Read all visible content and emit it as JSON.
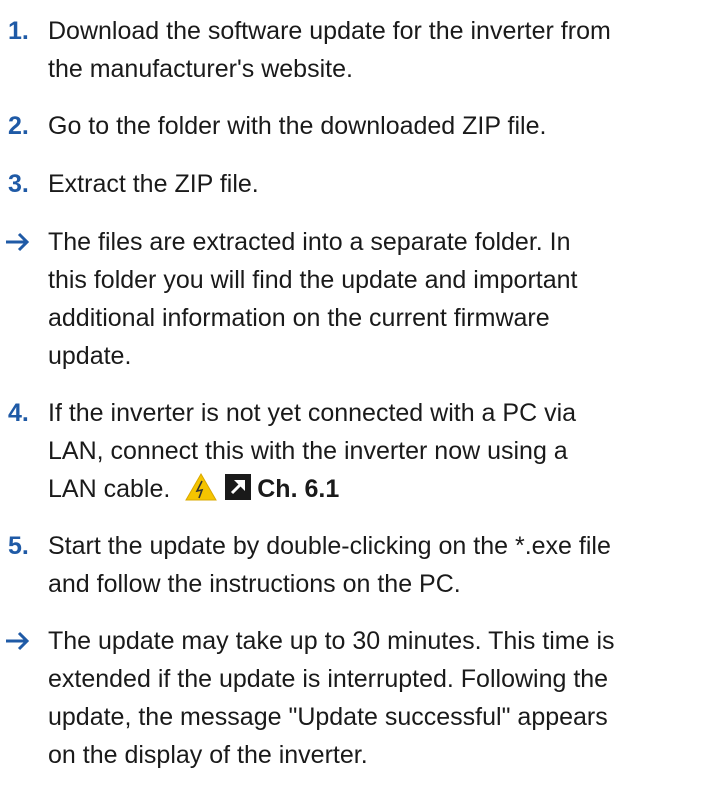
{
  "steps": [
    {
      "marker": "1.",
      "lines": [
        "Download the software update for the inverter from",
        "the manufacturer's website."
      ]
    },
    {
      "marker": "2.",
      "lines": [
        "Go to the folder with the downloaded ZIP file."
      ]
    },
    {
      "marker": "3.",
      "lines": [
        "Extract the ZIP file."
      ]
    },
    {
      "marker": "arrow-icon",
      "lines": [
        "The files are extracted into a separate folder. In",
        "this folder you will find the update and important",
        "additional information on the current firmware",
        "update."
      ]
    },
    {
      "marker": "4.",
      "lines": [
        "If the inverter is not yet connected with a PC via",
        "LAN, connect this with the inverter now using a",
        "LAN cable."
      ],
      "crossref": "Ch. 6.1"
    },
    {
      "marker": "5.",
      "lines": [
        "Start the update by double-clicking on the *.exe file",
        "and follow the instructions on the PC."
      ]
    },
    {
      "marker": "arrow-icon",
      "lines": [
        "The update may take up to 30 minutes. This time is",
        "extended if the update is interrupted. Following the",
        "update, the message \"Update successful\" appears",
        "on the display of the inverter."
      ]
    }
  ],
  "colors": {
    "marker": "#1f5aa6",
    "text": "#1a1a1a",
    "warning": "#f5c400"
  }
}
